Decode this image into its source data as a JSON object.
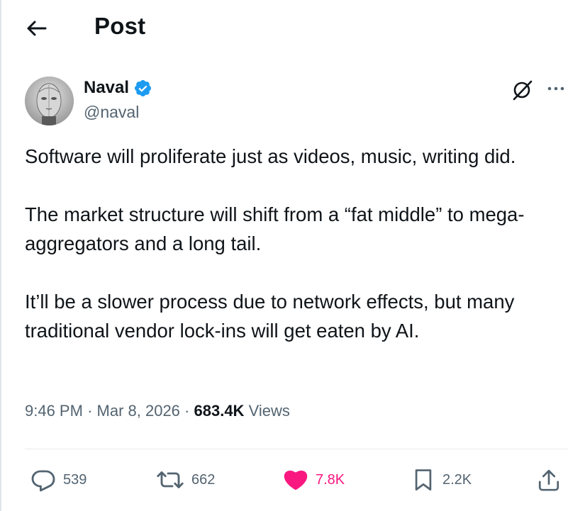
{
  "header": {
    "title": "Post",
    "back_icon": "arrow-left-icon"
  },
  "author": {
    "name": "Naval",
    "handle": "@naval",
    "verified": true,
    "verified_color": "#1d9bf0"
  },
  "tweet": {
    "paragraphs": [
      "Software will proliferate just as videos, music,  writing did.",
      "The market structure will shift from a “fat middle” to mega-aggregators and a long tail.",
      "It’ll be a slower process due to network effects, but many traditional vendor lock-ins will get eaten by AI."
    ]
  },
  "meta": {
    "time": "9:46 PM",
    "separator": "·",
    "date": "Mar 8, 2026",
    "views_count": "683.4K",
    "views_label": "Views"
  },
  "actions": {
    "replies": "539",
    "reposts": "662",
    "likes": "7.8K",
    "bookmarks": "2.2K"
  },
  "colors": {
    "like": "#f91880",
    "secondary_text": "#536471",
    "primary_text": "#0f1419"
  }
}
